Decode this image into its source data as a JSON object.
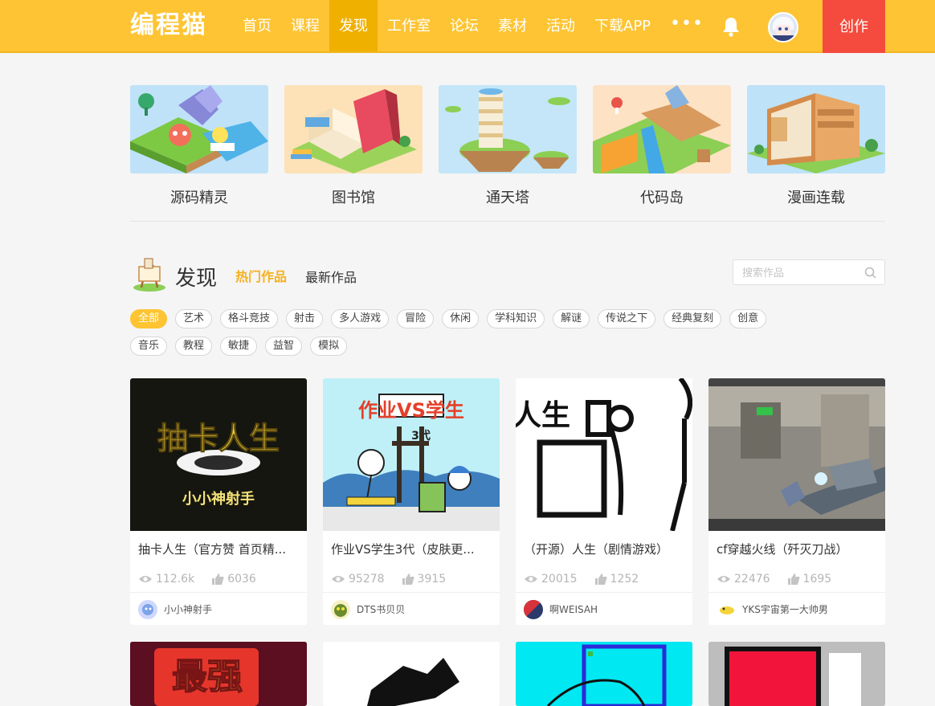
{
  "header": {
    "logo": "编程猫",
    "nav": [
      "首页",
      "课程",
      "发现",
      "工作室",
      "论坛",
      "素材",
      "活动",
      "下载APP"
    ],
    "more": "•••",
    "create": "创作"
  },
  "features": [
    "源码精灵",
    "图书馆",
    "通天塔",
    "代码岛",
    "漫画连载"
  ],
  "discover": {
    "title": "发现",
    "tab_hot": "热门作品",
    "tab_new": "最新作品",
    "search_placeholder": "搜索作品"
  },
  "tags_row1": [
    "全部",
    "艺术",
    "格斗竞技",
    "射击",
    "多人游戏",
    "冒险",
    "休闲",
    "学科知识",
    "解谜",
    "传说之下",
    "经典复刻",
    "创意"
  ],
  "tags_row2": [
    "音乐",
    "教程",
    "敏捷",
    "益智",
    "模拟"
  ],
  "works": [
    {
      "title": "抽卡人生（官方赞 首页精...",
      "views": "112.6k",
      "likes": "6036",
      "author": "小小神射手",
      "thumb_text": "抽卡人生",
      "thumb_sub": "小小神射手"
    },
    {
      "title": "作业VS学生3代（皮肤更...",
      "views": "95278",
      "likes": "3915",
      "author": "DTS书贝贝",
      "thumb_text": "作业VS学生",
      "thumb_sub": "3代"
    },
    {
      "title": "（开源）人生（剧情游戏）",
      "views": "20015",
      "likes": "1252",
      "author": "啊WEISAH",
      "thumb_text": "人生"
    },
    {
      "title": "cf穿越火线（歼灭刀战）",
      "views": "22476",
      "likes": "1695",
      "author": "YKS宇宙第一大帅男"
    }
  ],
  "works_row2_thumb": "最强",
  "colors": {
    "brand": "#fec433",
    "create": "#f44b3e",
    "tab_hot": "#f5b11e"
  }
}
